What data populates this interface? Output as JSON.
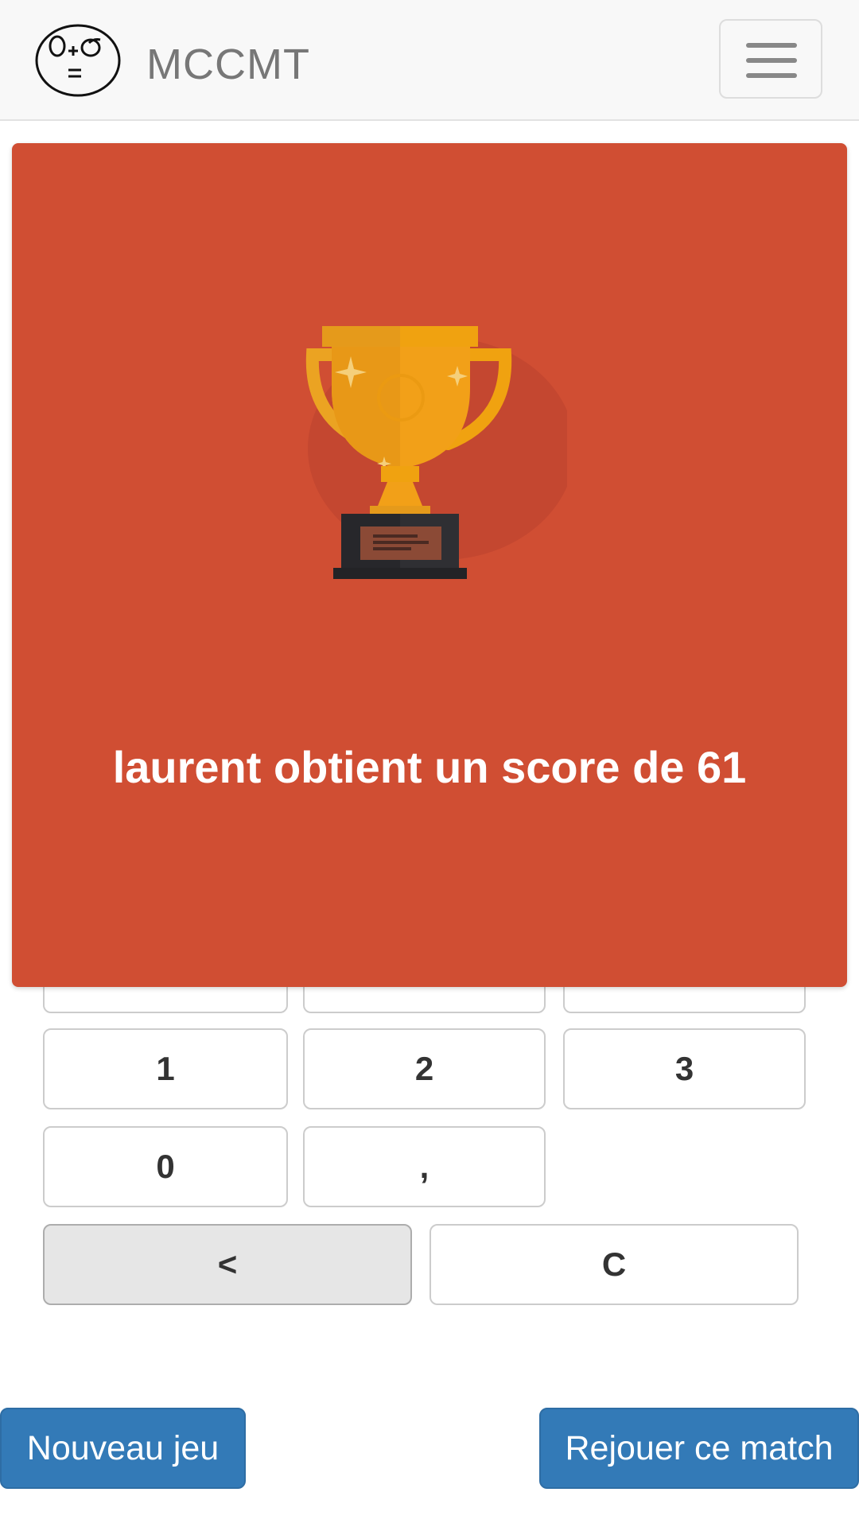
{
  "app": {
    "brand_name": "MCCMT",
    "logo_text": "O+O ="
  },
  "keypad": {
    "keys": [
      "1",
      "2",
      "3",
      "0",
      ","
    ],
    "backspace_label": "<",
    "clear_label": "C"
  },
  "result": {
    "message": "laurent obtient un score de 61"
  },
  "actions": {
    "new_game_label": "Nouveau jeu",
    "replay_label": "Rejouer ce match"
  },
  "colors": {
    "panel": "#d04e33",
    "primary_button": "#337ab7",
    "trophy_gold": "#f2a018",
    "trophy_base": "#2b2b2e"
  }
}
